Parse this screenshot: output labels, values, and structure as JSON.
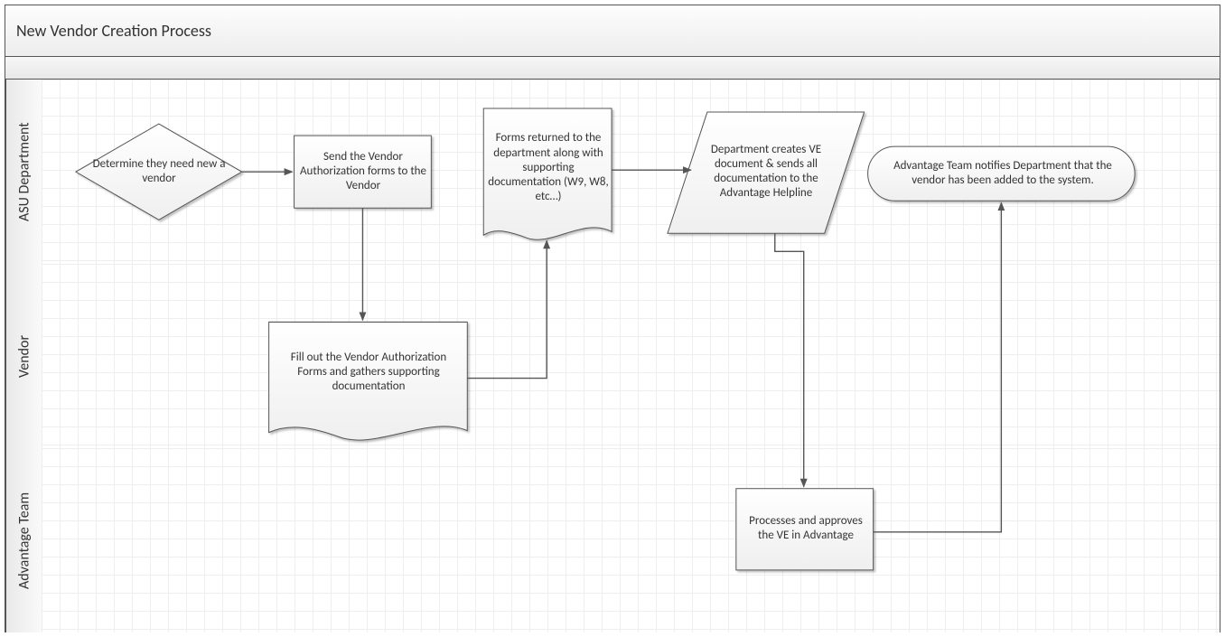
{
  "title": "New Vendor Creation Process",
  "lanes": {
    "lane1": "ASU Department",
    "lane2": "Vendor",
    "lane3": "Advantage Team"
  },
  "nodes": {
    "n1": "Determine they need new a vendor",
    "n2": "Send the Vendor Authorization forms to the Vendor",
    "n3": "Fill out the Vendor Authorization Forms and gathers supporting documentation",
    "n4": "Forms returned to the department along with supporting documentation (W9, W8, etc…)",
    "n5": "Department creates VE document & sends all documentation to the Advantage Helpline",
    "n6": "Processes and approves the VE in Advantage",
    "n7": "Advantage Team notifies Department that the vendor has been added to the system."
  }
}
